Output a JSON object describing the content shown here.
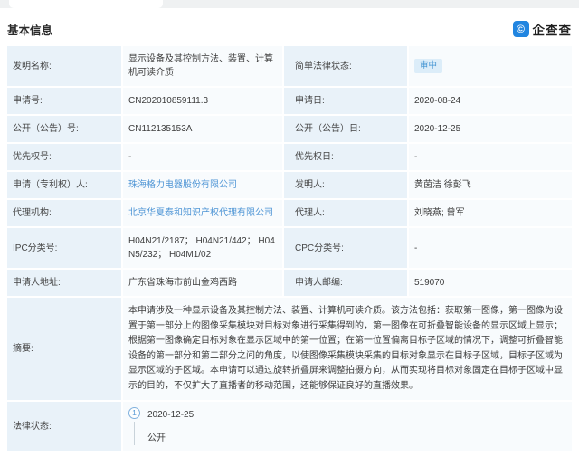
{
  "header": {
    "section_title": "基本信息",
    "logo_text": "企查查",
    "logo_glyph": "©"
  },
  "colors": {
    "label_bg": "#e9f2f9",
    "value_bg": "#f8fbfd",
    "link": "#4e95d5",
    "badge_bg": "#dcedf9",
    "badge_text": "#4193d2",
    "logo_blue": "#2185e0"
  },
  "table": {
    "rows": [
      {
        "label": "发明名称:",
        "value": "显示设备及其控制方法、装置、计算机可读介质",
        "label2": "简单法律状态:",
        "value2": "审中"
      },
      {
        "label": "申请号:",
        "value": "CN202010859111.3",
        "label2": "申请日:",
        "value2": "2020-08-24"
      },
      {
        "label": "公开（公告）号:",
        "value": "CN112135153A",
        "label2": "公开（公告）日:",
        "value2": "2020-12-25"
      },
      {
        "label": "优先权号:",
        "value": "-",
        "label2": "优先权日:",
        "value2": "-"
      },
      {
        "label": "申请（专利权）人:",
        "value": "珠海格力电器股份有限公司",
        "label2": "发明人:",
        "value2": "黄茵洁 徐彭飞"
      },
      {
        "label": "代理机构:",
        "value": "北京华夏泰和知识产权代理有限公司",
        "label2": "代理人:",
        "value2": "刘晓燕; 曾军"
      },
      {
        "label": "IPC分类号:",
        "value": "H04N21/2187； H04N21/442； H04N5/232； H04M1/02",
        "label2": "CPC分类号:",
        "value2": "-"
      },
      {
        "label": "申请人地址:",
        "value": "广东省珠海市前山金鸡西路",
        "label2": "申请人邮编:",
        "value2": "519070"
      }
    ],
    "abstract": {
      "label": "摘要:",
      "text": "本申请涉及一种显示设备及其控制方法、装置、计算机可读介质。该方法包括：获取第一图像，第一图像为设置于第一部分上的图像采集模块对目标对象进行采集得到的，第一图像在可折叠智能设备的显示区域上显示；根据第一图像确定目标对象在显示区域中的第一位置；在第一位置偏离目标子区域的情况下，调整可折叠智能设备的第一部分和第二部分之间的角度，以使图像采集模块采集的目标对象显示在目标子区域，目标子区域为显示区域的子区域。本申请可以通过旋转折叠屏来调整拍摄方向，从而实现将目标对象固定在目标子区域中显示的目的，不仅扩大了直播者的移动范围，还能够保证良好的直播效果。"
    },
    "legal_status": {
      "label": "法律状态:",
      "events": [
        {
          "index": "1",
          "date": "2020-12-25",
          "status": "公开"
        }
      ]
    }
  }
}
